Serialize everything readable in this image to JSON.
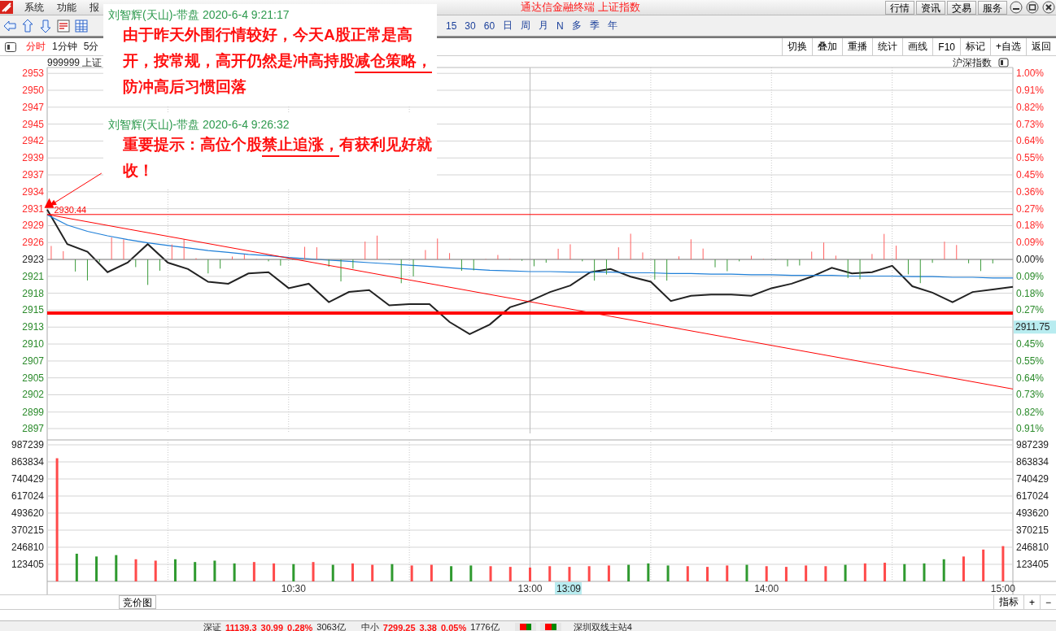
{
  "window": {
    "title": "通达信金融终端 上证指数"
  },
  "menu": [
    "系统",
    "功能",
    "报"
  ],
  "top_buttons": [
    "行情",
    "资讯",
    "交易",
    "服务"
  ],
  "periods": [
    "15",
    "30",
    "60",
    "日",
    "周",
    "月",
    "N",
    "多",
    "季",
    "年"
  ],
  "view_tabs": [
    {
      "label": "分时",
      "selected": true
    },
    {
      "label": "1分钟",
      "selected": false
    },
    {
      "label": "5分",
      "selected": false
    }
  ],
  "chart_tools": [
    "切换",
    "叠加",
    "重播",
    "统计",
    "画线",
    "F10",
    "标记",
    "+自选",
    "返回"
  ],
  "price_chart": {
    "symbol": "999999 上证",
    "overlay_label": "沪深指数",
    "marker_label": "2930.44",
    "percent_axis": [
      {
        "label": "1.00%",
        "kind": "up"
      },
      {
        "label": "0.91%",
        "kind": "up"
      },
      {
        "label": "0.82%",
        "kind": "up"
      },
      {
        "label": "0.73%",
        "kind": "up"
      },
      {
        "label": "0.64%",
        "kind": "up"
      },
      {
        "label": "0.55%",
        "kind": "up"
      },
      {
        "label": "0.45%",
        "kind": "up"
      },
      {
        "label": "0.36%",
        "kind": "up"
      },
      {
        "label": "0.27%",
        "kind": "up"
      },
      {
        "label": "0.18%",
        "kind": "up"
      },
      {
        "label": "0.09%",
        "kind": "up"
      },
      {
        "label": "0.00%",
        "kind": "flat"
      },
      {
        "label": "0.09%",
        "kind": "down"
      },
      {
        "label": "0.18%",
        "kind": "down"
      },
      {
        "label": "0.27%",
        "kind": "down"
      },
      {
        "label": "2911.75",
        "kind": "current"
      },
      {
        "label": "0.45%",
        "kind": "down"
      },
      {
        "label": "0.55%",
        "kind": "down"
      },
      {
        "label": "0.64%",
        "kind": "down"
      },
      {
        "label": "0.73%",
        "kind": "down"
      },
      {
        "label": "0.82%",
        "kind": "down"
      },
      {
        "label": "0.91%",
        "kind": "down"
      }
    ],
    "chart_data": {
      "type": "line",
      "grid": true,
      "categories": [
        null,
        null,
        null,
        null,
        null,
        null,
        null,
        null,
        null,
        null,
        null,
        null,
        null,
        null,
        null,
        null,
        null,
        null,
        null,
        null,
        null,
        null,
        null,
        null,
        null,
        null,
        null,
        null,
        null,
        null,
        null,
        null,
        null,
        null,
        null,
        null,
        null,
        null,
        null,
        null,
        null,
        null,
        null,
        null,
        null,
        null,
        null,
        null,
        null
      ],
      "series": [
        {
          "color": "#222222",
          "values": [
            2931.2,
            2925.8,
            2924.6,
            2921.4,
            2922.9,
            2925.8,
            2922.9,
            2921.9,
            2919.9,
            2919.6,
            2921.2,
            2921.4,
            2918.9,
            2919.6,
            2916.7,
            2918.3,
            2918.6,
            2916.2,
            2916.4,
            2916.4,
            2913.6,
            2911.7,
            2913.2,
            2915.9,
            2916.9,
            2918.3,
            2919.3,
            2921.4,
            2921.9,
            2920.7,
            2919.9,
            2916.9,
            2917.7,
            2917.9,
            2917.9,
            2917.7,
            2918.9,
            2919.6,
            2920.7,
            2922.1,
            2921.2,
            2921.4,
            2922.4,
            2919.2,
            2918.2,
            2916.7,
            2918.3,
            2918.7,
            2919.1
          ]
        },
        {
          "color": "#1e7fd8",
          "values": [
            2930.4,
            2928.8,
            2927.8,
            2927.1,
            2926.5,
            2926.0,
            2925.6,
            2925.2,
            2924.8,
            2924.5,
            2924.2,
            2924.0,
            2923.7,
            2923.5,
            2923.3,
            2923.1,
            2922.9,
            2922.7,
            2922.5,
            2922.3,
            2922.1,
            2921.9,
            2921.7,
            2921.6,
            2921.5,
            2921.5,
            2921.4,
            2921.4,
            2921.4,
            2921.3,
            2921.3,
            2921.2,
            2921.2,
            2921.1,
            2921.1,
            2921.0,
            2921.0,
            2920.9,
            2920.9,
            2920.9,
            2920.8,
            2920.8,
            2920.8,
            2920.7,
            2920.7,
            2920.6,
            2920.6,
            2920.5,
            2920.5
          ]
        }
      ],
      "ylim": [
        2896.4,
        2953.47
      ],
      "yticks": [
        {
          "value": 2952.55,
          "label": "2953"
        },
        {
          "value": 2949.9,
          "label": "2950"
        },
        {
          "value": 2947.25,
          "label": "2947"
        },
        {
          "value": 2944.6,
          "label": "2945"
        },
        {
          "value": 2941.95,
          "label": "2942"
        },
        {
          "value": 2939.3,
          "label": "2939"
        },
        {
          "value": 2936.65,
          "label": "2937"
        },
        {
          "value": 2934.0,
          "label": "2934"
        },
        {
          "value": 2931.35,
          "label": "2931"
        },
        {
          "value": 2928.7,
          "label": "2929"
        },
        {
          "value": 2926.05,
          "label": "2926"
        },
        {
          "value": 2923.4,
          "label": "2923"
        },
        {
          "value": 2920.75,
          "label": "2921"
        },
        {
          "value": 2918.1,
          "label": "2918"
        },
        {
          "value": 2915.45,
          "label": "2915"
        },
        {
          "value": 2912.8,
          "label": "2913"
        },
        {
          "value": 2910.15,
          "label": "2910"
        },
        {
          "value": 2907.49,
          "label": "2907"
        },
        {
          "value": 2904.85,
          "label": "2905"
        },
        {
          "value": 2902.2,
          "label": "2902"
        },
        {
          "value": 2899.49,
          "label": "2899"
        },
        {
          "value": 2896.9,
          "label": "2897"
        }
      ]
    }
  },
  "volume_chart": {
    "right_axis": [
      "987239",
      "863834",
      "740429",
      "617024",
      "493620",
      "370215",
      "246810",
      "123405"
    ],
    "cursor_time": "13:09",
    "chart_data": {
      "type": "bar",
      "grid": true,
      "categories": [
        null,
        null,
        null,
        null,
        null,
        null,
        null,
        null,
        null,
        null,
        null,
        null,
        "10:30",
        null,
        null,
        null,
        null,
        null,
        null,
        null,
        null,
        null,
        null,
        null,
        "13:00",
        null,
        null,
        null,
        null,
        null,
        null,
        null,
        null,
        null,
        null,
        null,
        "14:00",
        null,
        null,
        null,
        null,
        null,
        null,
        null,
        null,
        null,
        null,
        null,
        "15:00"
      ],
      "series": [
        {
          "values": [
            890000,
            200000,
            180000,
            190000,
            160000,
            150000,
            160000,
            140000,
            150000,
            130000,
            140000,
            130000,
            125000,
            140000,
            120000,
            130000,
            120000,
            125000,
            115000,
            120000,
            110000,
            115000,
            110000,
            105000,
            100000,
            110000,
            105000,
            110000,
            115000,
            120000,
            130000,
            115000,
            110000,
            105000,
            115000,
            120000,
            110000,
            105000,
            115000,
            110000,
            120000,
            130000,
            135000,
            125000,
            130000,
            160000,
            180000,
            230000,
            255000
          ]
        }
      ],
      "ylim": [
        0,
        987239
      ],
      "yticks": [
        987239,
        863834,
        740429,
        617024,
        493620,
        370215,
        246810,
        123405
      ]
    }
  },
  "bottom_tabs": [
    "竞价图"
  ],
  "indicator_buttons": [
    "指标",
    "+",
    "−"
  ],
  "status_bar": {
    "indices": [
      {
        "name": "深证",
        "value": "11139.3",
        "change": "30.99",
        "percent": "0.28%",
        "amount": "3063亿"
      },
      {
        "name": "中小",
        "value": "7299.25",
        "change": "3.38",
        "percent": "0.05%",
        "amount": "1776亿"
      }
    ],
    "server": "深圳双线主站4"
  },
  "annotations": [
    {
      "header": "刘智辉(天山)-带盘 2020-6-4 9:21:17",
      "segments": [
        {
          "text": "由于昨天外围行情较好，今天A股正常是高开，按常规，高开仍然是冲高持股",
          "underlined": false
        },
        {
          "text": "减仓策略，",
          "underlined": true
        },
        {
          "text": "防冲高后习惯回落",
          "underlined": false
        }
      ]
    },
    {
      "header": "刘智辉(天山)-带盘 2020-6-4 9:26:32",
      "segments": [
        {
          "text": "重要提示：高位个股",
          "underlined": false
        },
        {
          "text": "禁止追涨，",
          "underlined": true
        },
        {
          "text": "有获利见好就收！",
          "underlined": false
        }
      ]
    }
  ]
}
